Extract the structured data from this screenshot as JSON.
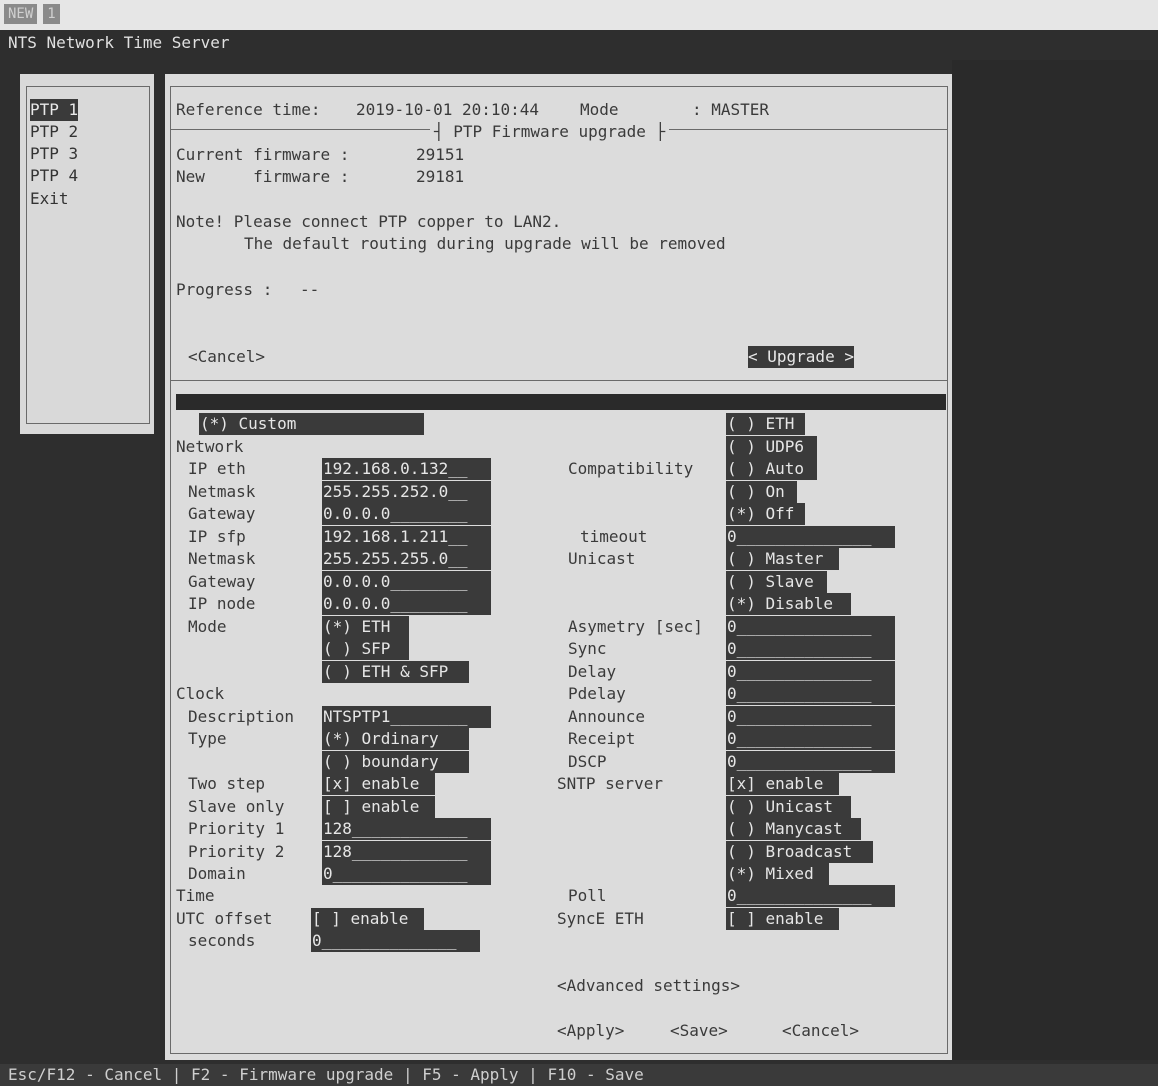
{
  "top_tabs": [
    "NEW",
    "1"
  ],
  "app_title": "NTS Network Time Server",
  "menu": {
    "items": [
      "PTP 1",
      "PTP 2",
      "PTP 3",
      "PTP 4",
      "Exit"
    ],
    "selected": "PTP 1"
  },
  "header": {
    "reference_time_label": "Reference time:",
    "reference_time": "2019-10-01 20:10:44",
    "mode_label": "Mode",
    "mode_value": ": MASTER"
  },
  "dialog": {
    "title": "PTP Firmware upgrade",
    "current_label": "Current firmware :",
    "current_value": "29151",
    "new_label": "New     firmware :",
    "new_value": "29181",
    "note_line1": "Note! Please connect PTP copper to LAN2.",
    "note_line2": "The default routing during upgrade will be removed",
    "progress_label": "Progress :",
    "progress_value": "--",
    "cancel": "<Cancel>",
    "upgrade": "< Upgrade >"
  },
  "form": {
    "custom": "(*) Custom",
    "network": "Network",
    "ip_eth_label": "IP eth",
    "ip_eth": "192.168.0.132__",
    "netmask1_label": "Netmask",
    "netmask1": "255.255.252.0__",
    "gateway1_label": "Gateway",
    "gateway1": "0.0.0.0________",
    "ip_sfp_label": "IP sfp",
    "ip_sfp": "192.168.1.211__",
    "netmask2_label": "Netmask",
    "netmask2": "255.255.255.0__",
    "gateway2_label": "Gateway",
    "gateway2": "0.0.0.0________",
    "ip_node_label": "IP node",
    "ip_node": "0.0.0.0________",
    "mode_label": "Mode",
    "mode_eth": "(*) ETH",
    "mode_sfp": "( ) SFP",
    "mode_both": "( ) ETH & SFP",
    "clock": "Clock",
    "description_label": "Description",
    "description": "NTSPTP1________",
    "type_label": "Type",
    "type_ordinary": "(*) Ordinary",
    "type_boundary": "( ) boundary",
    "two_step_label": "Two step",
    "two_step": "[x] enable",
    "slave_only_label": "Slave only",
    "slave_only": "[ ] enable",
    "priority1_label": "Priority 1",
    "priority1": "128____________",
    "priority2_label": "Priority 2",
    "priority2": "128____________",
    "domain_label": "Domain",
    "domain": "0______________",
    "time": "Time",
    "utc_offset_label": "UTC offset",
    "utc_offset": "[ ] enable",
    "seconds_label": "seconds",
    "seconds": "0______________",
    "transport_eth": "( ) ETH",
    "transport_udp6": "( ) UDP6",
    "compat_label": "Compatibility",
    "compat_auto": "( ) Auto",
    "compat_on": "( ) On",
    "compat_off": "(*) Off",
    "timeout_label": "timeout",
    "timeout": "0______________",
    "unicast_label": "Unicast",
    "unicast_master": "( ) Master",
    "unicast_slave": "( ) Slave",
    "unicast_disable": "(*) Disable",
    "asymetry_label": "Asymetry [sec]",
    "asymetry": "0______________",
    "sync_label": "Sync",
    "sync": "0______________",
    "delay_label": "Delay",
    "delay": "0______________",
    "pdelay_label": "Pdelay",
    "pdelay": "0______________",
    "announce_label": "Announce",
    "announce": "0______________",
    "receipt_label": "Receipt",
    "receipt": "0______________",
    "dscp_label": "DSCP",
    "dscp": "0______________",
    "sntp_label": "SNTP server",
    "sntp_enable": "[x] enable",
    "sntp_unicast": "( ) Unicast",
    "sntp_manycast": "( ) Manycast",
    "sntp_broadcast": "( ) Broadcast",
    "sntp_mixed": "(*) Mixed",
    "poll_label": "Poll",
    "poll": "0______________",
    "synce_label": "SyncE ETH",
    "synce": "[ ] enable",
    "advanced": "<Advanced settings>",
    "apply": "<Apply>",
    "save": "<Save>",
    "cancel": "<Cancel>"
  },
  "status_bar": "Esc/F12 - Cancel | F2 - Firmware upgrade | F5 - Apply | F10 - Save"
}
